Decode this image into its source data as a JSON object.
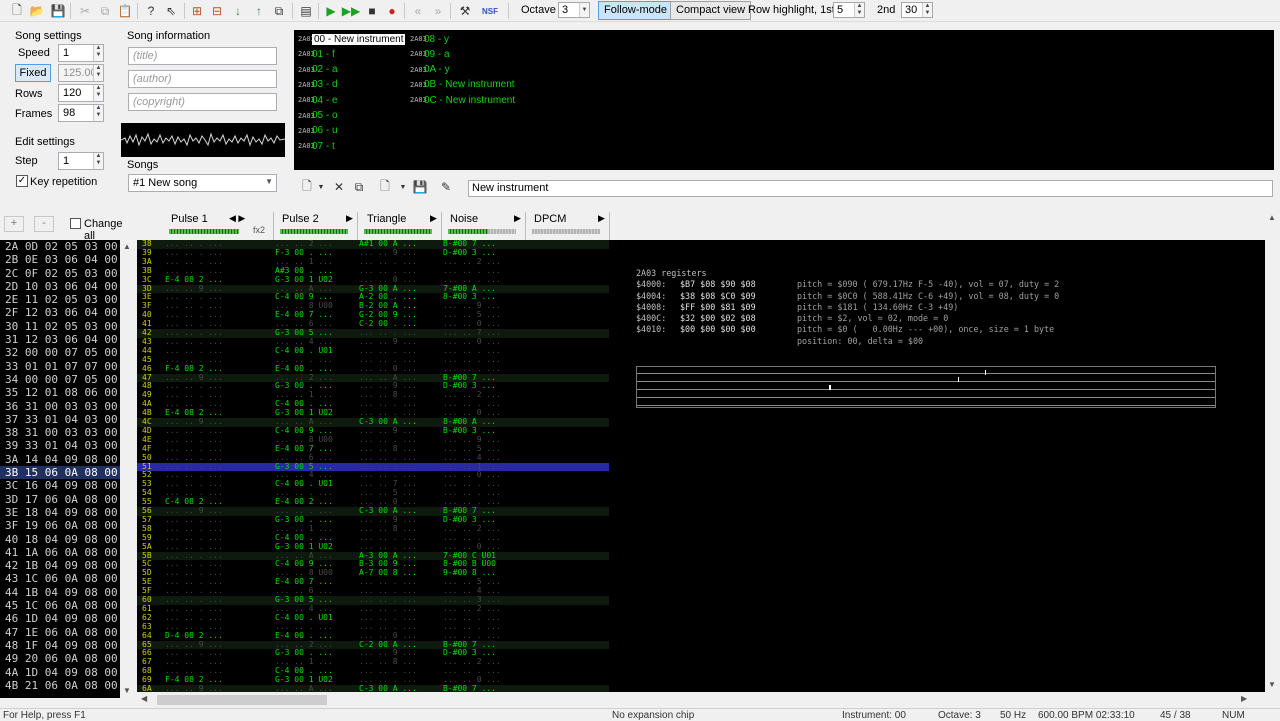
{
  "toolbar": {
    "octave_label": "Octave",
    "octave_value": "3",
    "follow_mode_label": "Follow-mode",
    "compact_view_label": "Compact view",
    "row_highlight_label": "Row highlight, 1st",
    "row_highlight_1st": "5",
    "second_label": "2nd",
    "row_highlight_2nd": "30",
    "icons": [
      "new-file-icon",
      "open-folder-icon",
      "save-icon",
      "cut-icon",
      "copy-icon",
      "paste-icon",
      "help-icon",
      "whats-this-icon",
      "insert-frame-icon",
      "duplicate-frame-icon",
      "move-down-icon",
      "move-up-icon",
      "clone-frame-icon",
      "module-properties-icon",
      "play-icon",
      "play-pattern-icon",
      "stop-icon",
      "record-icon",
      "previous-track-icon",
      "next-track-icon",
      "settings-icon",
      "nsf-export-icon"
    ]
  },
  "song_settings": {
    "title": "Song settings",
    "speed_label": "Speed",
    "speed_value": "1",
    "fixed_label": "Fixed",
    "tempo_value": "125.00",
    "rows_label": "Rows",
    "rows_value": "120",
    "frames_label": "Frames",
    "frames_value": "98"
  },
  "edit_settings": {
    "title": "Edit settings",
    "step_label": "Step",
    "step_value": "1",
    "key_repetition_label": "Key repetition",
    "key_repetition_checked": true
  },
  "song_information": {
    "title": "Song information",
    "title_placeholder": "(title)",
    "author_placeholder": "(author)",
    "copyright_placeholder": "(copyright)"
  },
  "songs": {
    "label": "Songs",
    "selected": "#1 New song"
  },
  "instruments": [
    {
      "chip": "2A03",
      "label": "00 - New instrument",
      "selected": true
    },
    {
      "chip": "2A03",
      "label": "01 - f"
    },
    {
      "chip": "2A03",
      "label": "02 - a"
    },
    {
      "chip": "2A03",
      "label": "03 - d"
    },
    {
      "chip": "2A03",
      "label": "04 - e"
    },
    {
      "chip": "2A03",
      "label": "05 - o"
    },
    {
      "chip": "2A03",
      "label": "06 - u"
    },
    {
      "chip": "2A03",
      "label": "07 - t"
    },
    {
      "chip": "2A03",
      "label": "08 - y"
    },
    {
      "chip": "2A03",
      "label": "09 - a"
    },
    {
      "chip": "2A03",
      "label": "0A - y"
    },
    {
      "chip": "2A03",
      "label": "0B - New instrument"
    },
    {
      "chip": "2A03",
      "label": "0C - New instrument"
    }
  ],
  "instrument_name": "New instrument",
  "frame_editor": {
    "add_label": "+",
    "remove_label": "-",
    "change_all_label": "Change all",
    "rows": [
      "2A 0D 02 05 03 00",
      "2B 0E 03 06 04 00",
      "2C 0F 02 05 03 00",
      "2D 10 03 06 04 00",
      "2E 11 02 05 03 00",
      "2F 12 03 06 04 00",
      "30 11 02 05 03 00",
      "31 12 03 06 04 00",
      "32 00 00 07 05 00",
      "33 01 01 07 07 00",
      "34 00 00 07 05 00",
      "35 12 01 08 06 00",
      "36 31 00 03 03 00",
      "37 33 01 04 03 00",
      "38 31 00 03 03 00",
      "39 33 01 04 03 00",
      "3A 14 04 09 08 00",
      "3B 15 06 0A 08 00",
      "3C 16 04 09 08 00",
      "3D 17 06 0A 08 00",
      "3E 18 04 09 08 00",
      "3F 19 06 0A 08 00",
      "40 18 04 09 08 00",
      "41 1A 06 0A 08 00",
      "42 1B 04 09 08 00",
      "43 1C 06 0A 08 00",
      "44 1B 04 09 08 00",
      "45 1C 06 0A 08 00",
      "46 1D 04 09 08 00",
      "47 1E 06 0A 08 00",
      "48 1F 04 09 08 00",
      "49 20 06 0A 08 00",
      "4A 1D 04 09 08 00",
      "4B 21 06 0A 08 00"
    ],
    "current_index": 17
  },
  "channels": [
    {
      "name": "Pulse 1",
      "fx": "fx2"
    },
    {
      "name": "Pulse 2"
    },
    {
      "name": "Triangle"
    },
    {
      "name": "Noise"
    },
    {
      "name": "DPCM"
    }
  ],
  "pattern": {
    "current_row": 25,
    "rows": [
      {
        "n": "38",
        "c": [
          "... .. . ...",
          "... .. 2 ...",
          "A#1 00 A ...",
          "B-#00 7 ..."
        ]
      },
      {
        "n": "39",
        "c": [
          "... .. . ...",
          "F-3 00 . ...",
          "... .. 9 ...",
          "D-#00 3 ..."
        ]
      },
      {
        "n": "3A",
        "c": [
          "... .. . ...",
          "... .. 1 ...",
          "... .. . ...",
          "... .. 2 ..."
        ]
      },
      {
        "n": "3B",
        "c": [
          "... .. . ...",
          "A#3 00 . ...",
          "... .. . ...",
          "... .. . ..."
        ]
      },
      {
        "n": "3C",
        "c": [
          "E-4 08 2 ...",
          "G-3 00 1 U02",
          "... .. 0 ...",
          "... .. . ..."
        ]
      },
      {
        "n": "3D",
        "c": [
          "... .. 9 ...",
          "... .. A ...",
          "G-3 00 A ...",
          "7-#00 A ..."
        ]
      },
      {
        "n": "3E",
        "c": [
          "... .. . ...",
          "C-4 00 9 ...",
          "A-2 00 . ...",
          "8-#00 3 ..."
        ]
      },
      {
        "n": "3F",
        "c": [
          "... .. . ...",
          "... .. 8 U00",
          "B-2 00 A ...",
          "... .. 9 ..."
        ]
      },
      {
        "n": "40",
        "c": [
          "... .. . ...",
          "E-4 00 7 ...",
          "G-2 00 9 ...",
          "... .. 5 ..."
        ]
      },
      {
        "n": "41",
        "c": [
          "... .. . ...",
          "... .. 6 ...",
          "C-2 00 . ...",
          "... .. 0 ..."
        ]
      },
      {
        "n": "42",
        "c": [
          "... .. . ...",
          "G-3 00 5 ...",
          "... .. . ...",
          "... .. 7 ..."
        ]
      },
      {
        "n": "43",
        "c": [
          "... .. . ...",
          "... .. 4 ...",
          "... .. 9 ...",
          "... .. 0 ..."
        ]
      },
      {
        "n": "44",
        "c": [
          "... .. . ...",
          "C-4 00 . U01",
          "... .. . ...",
          "... .. . ..."
        ]
      },
      {
        "n": "45",
        "c": [
          "... .. . ...",
          "... .. . ...",
          "... .. . ...",
          "... .. . ..."
        ]
      },
      {
        "n": "46",
        "c": [
          "F-4 08 2 ...",
          "E-4 00 . ...",
          "... .. 0 ...",
          "... .. . ..."
        ]
      },
      {
        "n": "47",
        "c": [
          "... .. 9 ...",
          "... .. 2 ...",
          "... .. A ...",
          "B-#00 7 ..."
        ]
      },
      {
        "n": "48",
        "c": [
          "... .. . ...",
          "G-3 00 . ...",
          "... .. 9 ...",
          "D-#00 3 ..."
        ]
      },
      {
        "n": "49",
        "c": [
          "... .. . ...",
          "... .. 1 ...",
          "... .. 8 ...",
          "... .. 2 ..."
        ]
      },
      {
        "n": "4A",
        "c": [
          "... .. . ...",
          "C-4 00 . ...",
          "... .. . ...",
          "... .. . ..."
        ]
      },
      {
        "n": "4B",
        "c": [
          "E-4 08 2 ...",
          "G-3 00 1 U02",
          "... .. . ...",
          "... .. 0 ..."
        ]
      },
      {
        "n": "4C",
        "c": [
          "... .. 9 ...",
          "... .. A ...",
          "C-3 00 A ...",
          "8-#00 A ..."
        ]
      },
      {
        "n": "4D",
        "c": [
          "... .. . ...",
          "C-4 00 9 ...",
          "... .. 9 ...",
          "B-#00 3 ..."
        ]
      },
      {
        "n": "4E",
        "c": [
          "... .. . ...",
          "... .. 8 U00",
          "... .. . ...",
          "... .. 9 ..."
        ]
      },
      {
        "n": "4F",
        "c": [
          "... .. . ...",
          "E-4 00 7 ...",
          "... .. 8 ...",
          "... .. 5 ..."
        ]
      },
      {
        "n": "50",
        "c": [
          "... .. . ...",
          "... .. 6 ...",
          "... .. . ...",
          "... .. 4 ..."
        ]
      },
      {
        "n": "51",
        "c": [
          "... .. . ...",
          "G-3 00 5 ...",
          "... .. . ...",
          "... .. 1 ..."
        ]
      },
      {
        "n": "52",
        "c": [
          "... .. . ...",
          "... .. 4 ...",
          "... .. . ...",
          "... .. 0 ..."
        ]
      },
      {
        "n": "53",
        "c": [
          "... .. . ...",
          "C-4 00 . U01",
          "... .. 7 ...",
          "... .. . ..."
        ]
      },
      {
        "n": "54",
        "c": [
          "... .. . ...",
          "... .. . ...",
          "... .. 5 ...",
          "... .. . ..."
        ]
      },
      {
        "n": "55",
        "c": [
          "C-4 08 2 ...",
          "E-4 00 2 ...",
          "... .. 0 ...",
          "... .. . ..."
        ]
      },
      {
        "n": "56",
        "c": [
          "... .. 9 ...",
          "... .. . ...",
          "C-3 00 A ...",
          "B-#00 7 ..."
        ]
      },
      {
        "n": "57",
        "c": [
          "... .. . ...",
          "G-3 00 . ...",
          "... .. 9 ...",
          "D-#00 3 ..."
        ]
      },
      {
        "n": "58",
        "c": [
          "... .. . ...",
          "... .. 1 ...",
          "... .. 8 ...",
          "... .. 2 ..."
        ]
      },
      {
        "n": "59",
        "c": [
          "... .. . ...",
          "C-4 00 . ...",
          "... .. . ...",
          "... .. . ..."
        ]
      },
      {
        "n": "5A",
        "c": [
          "... .. . ...",
          "G-3 00 1 U02",
          "... .. . ...",
          "... .. 0 ..."
        ]
      },
      {
        "n": "5B",
        "c": [
          "... .. . ...",
          "... .. A ...",
          "A-3 00 A ...",
          "7-#00 C U01"
        ]
      },
      {
        "n": "5C",
        "c": [
          "... .. . ...",
          "C-4 00 9 ...",
          "B-3 00 9 ...",
          "8-#00 B U00"
        ]
      },
      {
        "n": "5D",
        "c": [
          "... .. . ...",
          "... .. 8 U00",
          "A-7 00 8 ...",
          "9-#00 8 ..."
        ]
      },
      {
        "n": "5E",
        "c": [
          "... .. . ...",
          "E-4 00 7 ...",
          "... .. . ...",
          "... .. 5 ..."
        ]
      },
      {
        "n": "5F",
        "c": [
          "... .. . ...",
          "... .. 6 ...",
          "... .. . ...",
          "... .. 4 ..."
        ]
      },
      {
        "n": "60",
        "c": [
          "... .. . ...",
          "G-3 00 5 ...",
          "... .. . ...",
          "... .. 3 ..."
        ]
      },
      {
        "n": "61",
        "c": [
          "... .. . ...",
          "... .. 4 ...",
          "... .. . ...",
          "... .. 2 ..."
        ]
      },
      {
        "n": "62",
        "c": [
          "... .. . ...",
          "C-4 00 . U01",
          "... .. . ...",
          "... .. . ..."
        ]
      },
      {
        "n": "63",
        "c": [
          "... .. . ...",
          "... .. . ...",
          "... .. . ...",
          "... .. . ..."
        ]
      },
      {
        "n": "64",
        "c": [
          "D-4 08 2 ...",
          "E-4 00 . ...",
          "... .. 0 ...",
          "... .. . ..."
        ]
      },
      {
        "n": "65",
        "c": [
          "... .. 9 ...",
          "... .. 2 ...",
          "C-2 00 A ...",
          "B-#00 7 ..."
        ]
      },
      {
        "n": "66",
        "c": [
          "... .. . ...",
          "G-3 00 . ...",
          "... .. 9 ...",
          "D-#00 3 ..."
        ]
      },
      {
        "n": "67",
        "c": [
          "... .. . ...",
          "... .. 1 ...",
          "... .. 8 ...",
          "... .. 2 ..."
        ]
      },
      {
        "n": "68",
        "c": [
          "... .. . ...",
          "C-4 00 . ...",
          "... .. . ...",
          "... .. . ..."
        ]
      },
      {
        "n": "69",
        "c": [
          "F-4 08 2 ...",
          "G-3 00 1 U02",
          "... .. . ...",
          "... .. 0 ..."
        ]
      },
      {
        "n": "6A",
        "c": [
          "... .. 9 ...",
          "... .. A ...",
          "C-3 00 A ...",
          "B-#00 7 ..."
        ]
      }
    ]
  },
  "registers": {
    "title": "2A03 registers",
    "lines": [
      {
        "addr": "$4000:",
        "vals": "$B7 $08 $90 $08",
        "info": "pitch = $090 ( 679.17Hz F-5 -40), vol = 07, duty = 2"
      },
      {
        "addr": "$4004:",
        "vals": "$38 $08 $C0 $09",
        "info": "pitch = $0C0 ( 588.41Hz C-6 +49), vol = 08, duty = 0"
      },
      {
        "addr": "$4008:",
        "vals": "$FF $00 $81 $09",
        "info": "pitch = $181 ( 134.60Hz C-3 +49)"
      },
      {
        "addr": "$400C:",
        "vals": "$32 $00 $02 $08",
        "info": "pitch = $2, vol = 02, mode = 0"
      },
      {
        "addr": "$4010:",
        "vals": "$00 $00 $00 $00",
        "info": "pitch = $0 (   0.00Hz --- +00), once, size = 1 byte"
      },
      {
        "addr": "",
        "vals": "",
        "info": "position: 00, delta = $00"
      }
    ]
  },
  "status": {
    "help": "For Help, press F1",
    "expansion": "No expansion chip",
    "instrument": "Instrument: 00",
    "octave": "Octave: 3",
    "rate": "50 Hz",
    "tempo_time": "600.00 BPM  02:33:10",
    "position": "45 / 38",
    "num": "NUM"
  }
}
